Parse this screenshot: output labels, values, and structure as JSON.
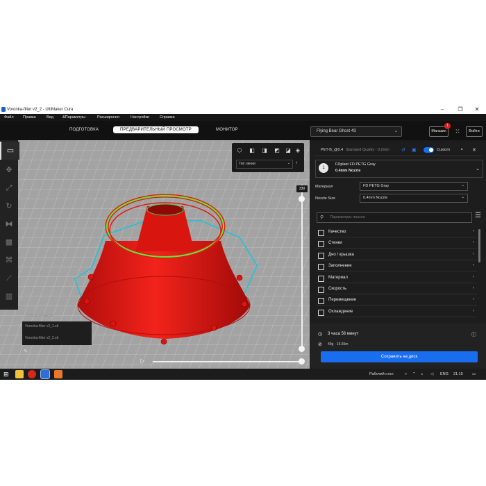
{
  "window": {
    "title": "Voronka-filter v2_2 - UltiMaker Cura"
  },
  "menu": [
    "Файл",
    "Правка",
    "Вид",
    "&Параметры",
    "Расширения",
    "Настройки",
    "Справка"
  ],
  "stages": {
    "prepare": "ПОДГОТОВКА",
    "preview": "ПРЕДВАРИТЕЛЬНЫЙ ПРОСМОТР",
    "monitor": "МОНИТОР"
  },
  "printer": {
    "name": "Flying Bear Ghost 4S"
  },
  "header_buttons": {
    "marketplace": "Магазин",
    "login": "Войти",
    "badge": "1"
  },
  "view": {
    "line_type": "Тип линии"
  },
  "layer": {
    "top": "330"
  },
  "objects": {
    "header": "Список объектов",
    "items": [
      "Voronka-filter v2_1.stl",
      "Voronka-filter v2_2.stl"
    ]
  },
  "profile": {
    "summary": "PET-B_@0.4",
    "quality": "Standard Quality - 0.2mm",
    "mode": "Custom"
  },
  "extruder": {
    "number": "1",
    "material_name": "FDplast FD PETG Gray",
    "nozzle": "0.4mm Nozzle"
  },
  "material": {
    "label": "Материал",
    "value": "FD PETG Gray"
  },
  "nozzle": {
    "label": "Nozzle Size",
    "value": "0.4mm Nozzle"
  },
  "search": {
    "placeholder": "Параметры поиска"
  },
  "settings_sections": [
    "Качество",
    "Стенки",
    "Дно / крышка",
    "Заполнение",
    "Материал",
    "Скорость",
    "Перемещение",
    "Охлаждение"
  ],
  "estimate": {
    "time": "3 часа 56 минут",
    "material": "49g · 16.65m"
  },
  "save_button": "Сохранить на диск",
  "taskbar": {
    "desktop": "Рабочий стол",
    "lang": "ENG",
    "time": "21:15"
  },
  "colors": {
    "model": "#ef1a14",
    "shell": "#1ec3d8",
    "wall_highlight": "#67e23c",
    "accent": "#196ef0"
  }
}
